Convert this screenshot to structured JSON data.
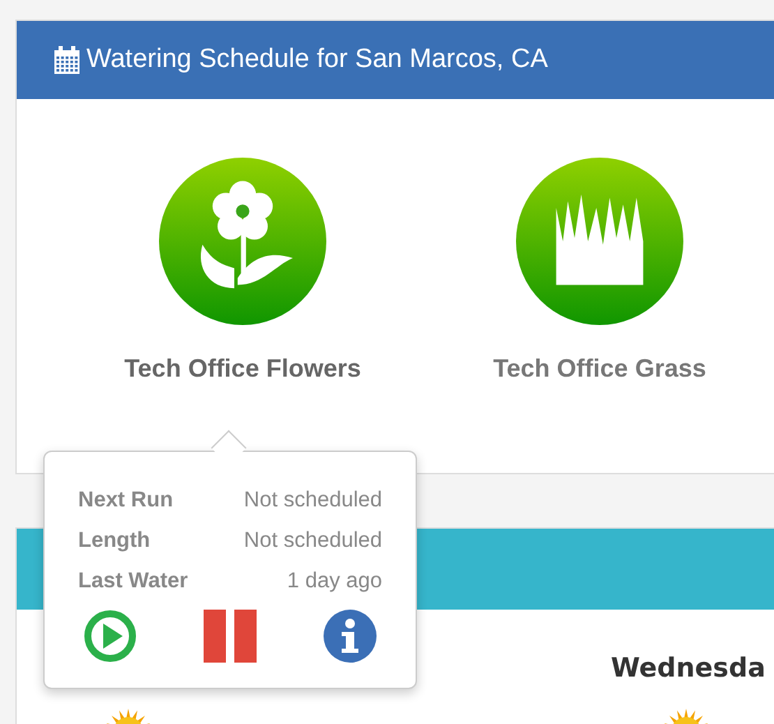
{
  "schedule": {
    "title": "Watering Schedule for San Marcos, CA",
    "zones": [
      {
        "name": "Tech Office Flowers",
        "kind": "flowers",
        "selected": true
      },
      {
        "name": "Tech Office Grass",
        "kind": "grass",
        "selected": false
      }
    ]
  },
  "popover": {
    "rows": [
      {
        "label": "Next Run",
        "value": "Not scheduled"
      },
      {
        "label": "Length",
        "value": "Not scheduled"
      },
      {
        "label": "Last Water",
        "value": "1 day ago"
      }
    ],
    "actions": [
      {
        "kind": "play"
      },
      {
        "kind": "pause"
      },
      {
        "kind": "info"
      }
    ]
  },
  "forecast": {
    "days": [
      {
        "name": "Wednesda"
      }
    ]
  }
}
